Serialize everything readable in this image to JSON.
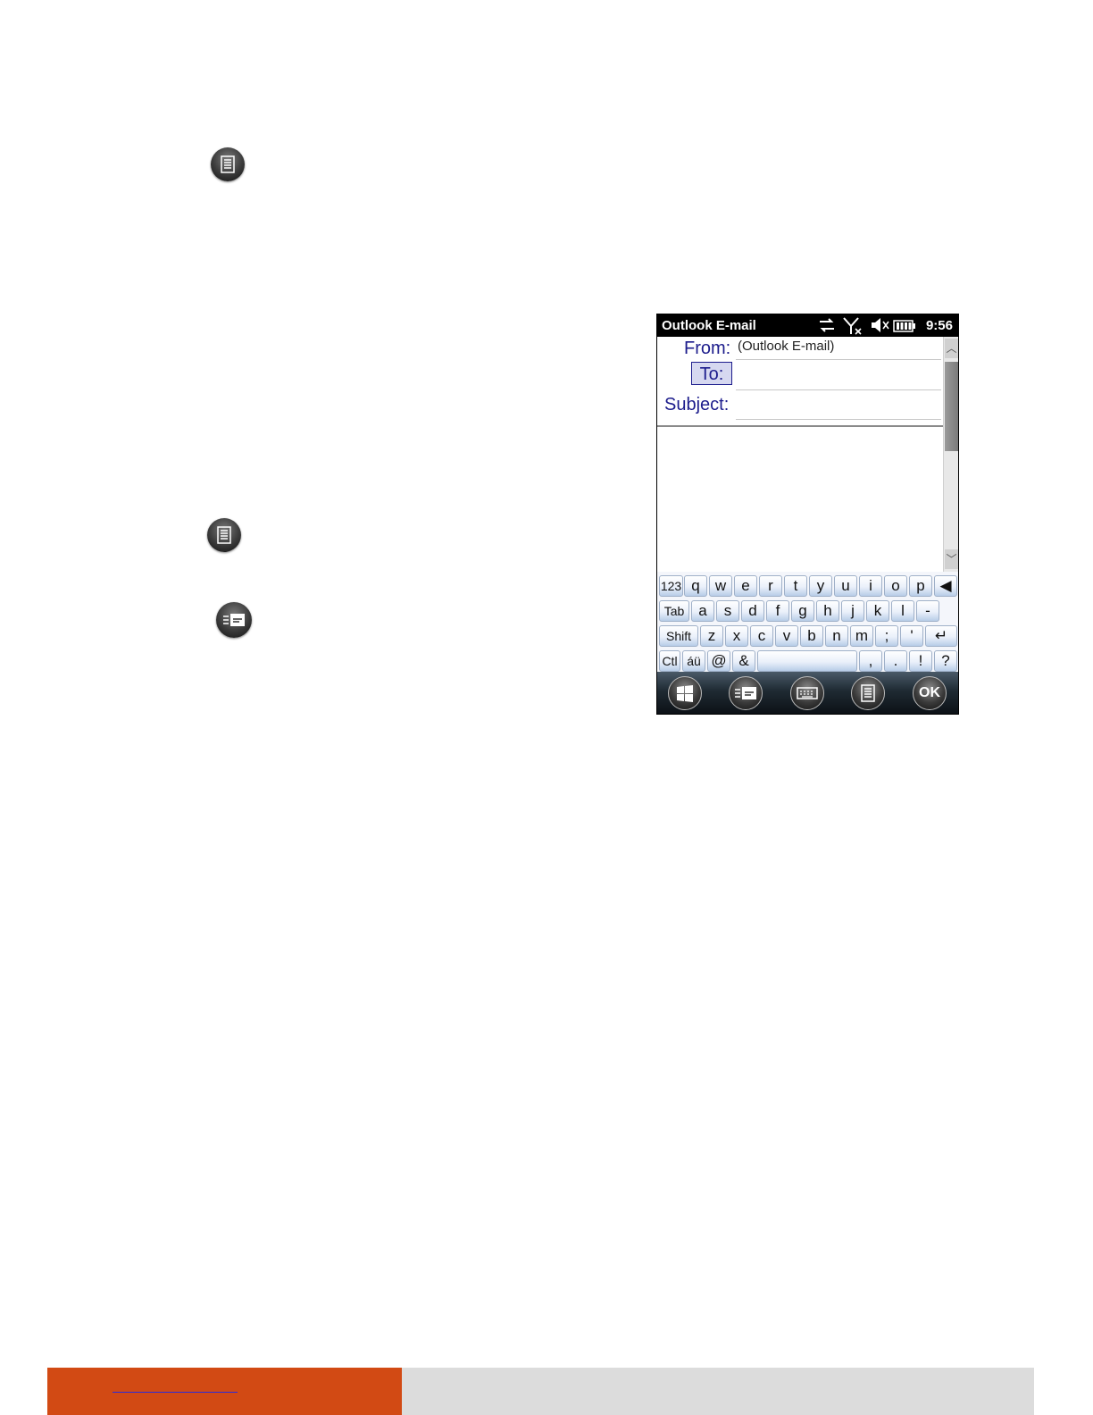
{
  "device": {
    "app_title": "Outlook E-mail",
    "time": "9:56",
    "from_label": "From:",
    "from_value": "(Outlook E-mail)",
    "to_label": "To:",
    "subject_label": "Subject:",
    "keyboard": {
      "row1": [
        "123",
        "q",
        "w",
        "e",
        "r",
        "t",
        "y",
        "u",
        "i",
        "o",
        "p"
      ],
      "row2": [
        "Tab",
        "a",
        "s",
        "d",
        "f",
        "g",
        "h",
        "j",
        "k",
        "l",
        "-"
      ],
      "row3": [
        "Shift",
        "z",
        "x",
        "c",
        "v",
        "b",
        "n",
        "m",
        ";",
        "'"
      ],
      "row4": [
        "Ctl",
        "áü",
        "@",
        "&",
        "",
        ",",
        ".",
        "!",
        "?"
      ]
    },
    "taskbar": {
      "ok_label": "OK"
    },
    "icons": [
      "windows-start-icon",
      "send-mail-icon",
      "keyboard-icon",
      "menu-icon",
      "ok-button"
    ]
  },
  "margin_icons": [
    "menu-icon",
    "menu-icon",
    "send-mail-icon"
  ],
  "colors": {
    "footer_accent": "#d24a14",
    "footer_gray": "#dcdcdc",
    "link_blue": "#2a2adb"
  }
}
